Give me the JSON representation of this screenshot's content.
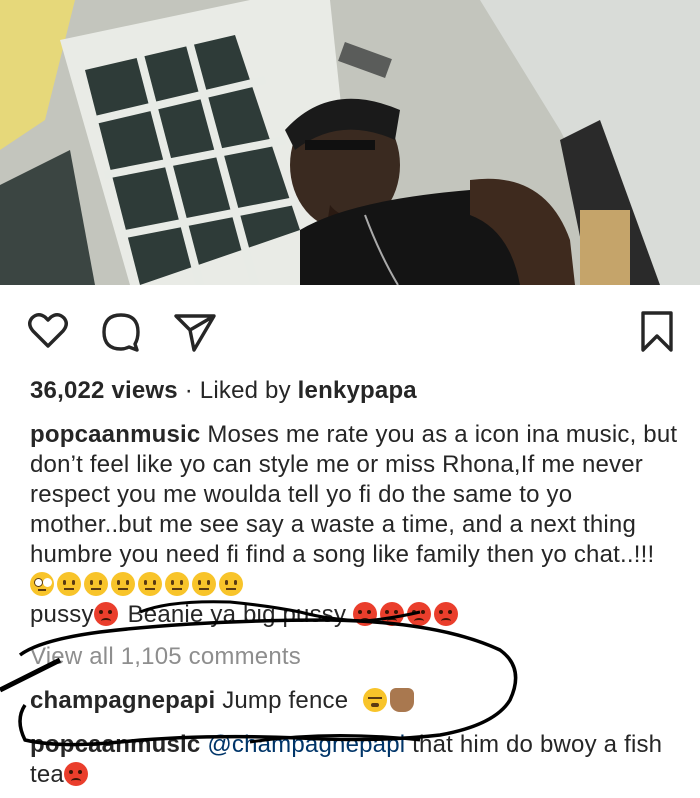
{
  "post": {
    "views": "36,022 views",
    "liked_by_prefix": "· Liked by",
    "liked_by_user": "lenkypapa"
  },
  "caption": {
    "username": "popcaanmusic",
    "line1": "Moses me rate you as a icon ina music, but don’t feel like yo can style me or miss Rhona,If me never respect you me woulda tell yo fi do the same to yo mother..but me see say a waste a time, and a next thing humbre you need fi find a song like family then yo chat..!!!",
    "line2_a": "pussy",
    "line2_b": "Beanie ya big pussy",
    "emojis_line1": [
      "face-with-rolling-eyes",
      "neutral-face",
      "neutral-face",
      "neutral-face",
      "neutral-face",
      "neutral-face",
      "neutral-face",
      "neutral-face"
    ],
    "emojis_line2": [
      "angry-face",
      "angry-face",
      "angry-face",
      "angry-face"
    ]
  },
  "view_all_comments": "View all 1,105 comments",
  "comments": [
    {
      "username": "champagnepapi",
      "text": "Jump fence",
      "emojis": [
        "face-with-steam",
        "sign-of-the-horns"
      ]
    },
    {
      "username": "popcaanmusic",
      "mention": "@champagnepapi",
      "text": "that him do bwoy a fish tea",
      "emojis": [
        "angry-face"
      ]
    }
  ],
  "icons": {
    "like": "heart-icon",
    "comment": "comment-bubble-icon",
    "share": "paper-plane-icon",
    "save": "bookmark-icon"
  },
  "colors": {
    "text": "#262626",
    "muted": "#8e8e8e",
    "mention": "#003569",
    "scribble": "#000000"
  }
}
